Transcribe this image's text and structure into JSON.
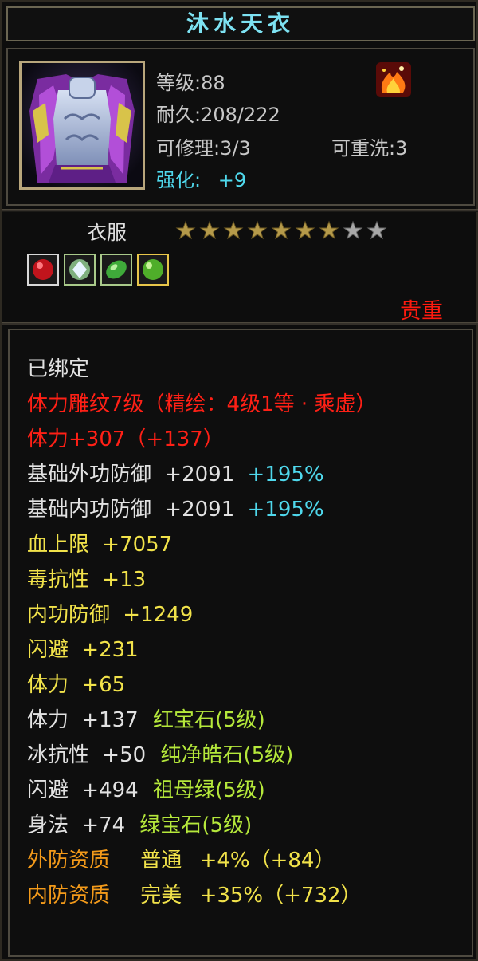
{
  "item": {
    "name": "沐水天衣",
    "level": "等级:88",
    "durability": "耐久:208/222",
    "repair": "可修理:3/3",
    "rewash": "可重洗:3",
    "enhance_label": "强化:",
    "enhance_value": "+9",
    "badge_icon": "flame-emblem-icon",
    "type": "衣服",
    "stars": {
      "filled": 7,
      "total": 9
    },
    "gems": [
      "ruby-gem-icon",
      "diamond-gem-icon",
      "emerald-gem-icon",
      "green-gem-icon"
    ],
    "rarity": "贵重"
  },
  "attributes": {
    "bound": "已绑定",
    "engrave": "体力雕纹7级（精绘：4级1等 · 乘虚）",
    "stamina_main": {
      "text": "体力+307（+137）"
    },
    "ext_def": {
      "label": "基础外功防御",
      "value": "+2091",
      "pct": "+195%"
    },
    "int_def": {
      "label": "基础内功防御",
      "value": "+2091",
      "pct": "+195%"
    },
    "hp": {
      "label": "血上限",
      "value": "+7057"
    },
    "poison": {
      "label": "毒抗性",
      "value": "+13"
    },
    "int_def2": {
      "label": "内功防御",
      "value": "+1249"
    },
    "dodge": {
      "label": "闪避",
      "value": "+231"
    },
    "stamina": {
      "label": "体力",
      "value": "+65"
    },
    "gem1": {
      "label": "体力",
      "value": "+137",
      "gem": "红宝石(5级)"
    },
    "gem2": {
      "label": "冰抗性",
      "value": "+50",
      "gem": "纯净皓石(5级)"
    },
    "gem3": {
      "label": "闪避",
      "value": "+494",
      "gem": "祖母绿(5级)"
    },
    "gem4": {
      "label": "身法",
      "value": "+74",
      "gem": "绿宝石(5级)"
    },
    "q1": {
      "label": "外防资质",
      "grade": "普通",
      "value": "+4%（+84）"
    },
    "q2": {
      "label": "内防资质",
      "grade": "完美",
      "value": "+35%（+732）"
    }
  },
  "colors": {
    "title": "#7de2f2",
    "cyan": "#4fd8ec",
    "red": "#ff2016",
    "yellow": "#f1e24a",
    "green": "#b5e83b",
    "orange": "#f39a1a"
  }
}
